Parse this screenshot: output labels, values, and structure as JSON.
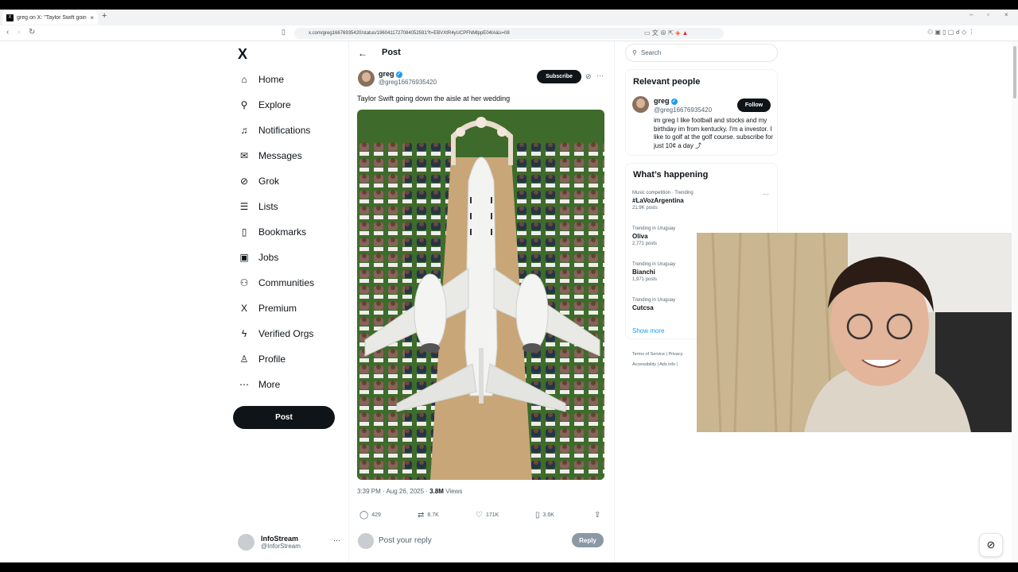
{
  "browser": {
    "tab_title": "greg on X: \"Taylor Swift going d...",
    "tab_close": "×",
    "new_tab": "+",
    "url": "x.com/greg16676935420/status/1960411727084052591?t=EBVXtR4yUCPFNMlppE04IA&s=08",
    "window_controls": [
      "–",
      "▫",
      "×"
    ]
  },
  "nav": {
    "logo": "X",
    "items": [
      {
        "label": "Home",
        "icon": "⌂"
      },
      {
        "label": "Explore",
        "icon": "⚲"
      },
      {
        "label": "Notifications",
        "icon": "♫"
      },
      {
        "label": "Messages",
        "icon": "✉"
      },
      {
        "label": "Grok",
        "icon": "⊘"
      },
      {
        "label": "Lists",
        "icon": "☰"
      },
      {
        "label": "Bookmarks",
        "icon": "▯"
      },
      {
        "label": "Jobs",
        "icon": "▣"
      },
      {
        "label": "Communities",
        "icon": "⚇"
      },
      {
        "label": "Premium",
        "icon": "X"
      },
      {
        "label": "Verified Orgs",
        "icon": "ϟ"
      },
      {
        "label": "Profile",
        "icon": "♙"
      },
      {
        "label": "More",
        "icon": "⋯"
      }
    ],
    "post_button": "Post",
    "account": {
      "name": "InfoStream",
      "handle": "@InforStream",
      "menu": "···"
    }
  },
  "post": {
    "back": "←",
    "header_title": "Post",
    "author": {
      "name": "greg",
      "handle": "@greg16676935420"
    },
    "subscribe_label": "Subscribe",
    "menu": "···",
    "text": "Taylor Swift going down the aisle at her wedding",
    "time": "3:39 PM · Aug 26, 2025 · ",
    "views_count": "3.8M",
    "views_label": " Views",
    "actions": [
      {
        "name": "reply",
        "icon": "◯",
        "count": "429"
      },
      {
        "name": "repost",
        "icon": "⇄",
        "count": "8.7K"
      },
      {
        "name": "like",
        "icon": "♡",
        "count": "171K"
      },
      {
        "name": "bookmark",
        "icon": "▯",
        "count": "3.6K"
      },
      {
        "name": "share",
        "icon": "⇪",
        "count": ""
      }
    ],
    "reply_placeholder": "Post your reply",
    "reply_button": "Reply"
  },
  "sidebar": {
    "search_placeholder": "Search",
    "relevant_title": "Relevant people",
    "person": {
      "name": "greg",
      "handle": "@greg16676935420",
      "follow_label": "Follow",
      "bio": "im greg I like football and stocks and my birthday im from kentucky. I'm a investor. I like to golf at the golf course. subscribe for just 10¢ a day ⤴"
    },
    "happening_title": "What’s happening",
    "trends": [
      {
        "context": "Music competition · Trending",
        "name": "#LaVozArgentina",
        "count": "21.9K posts"
      },
      {
        "context": "Trending in Uruguay",
        "name": "Oliva",
        "count": "2,771 posts"
      },
      {
        "context": "Trending in Uruguay",
        "name": "Bianchi",
        "count": "1,971 posts"
      },
      {
        "context": "Trending in Uruguay",
        "name": "Cutcsa",
        "count": ""
      }
    ],
    "trend_menu": "···",
    "show_more": "Show more",
    "footer_line1": "Terms of Service  |  Privacy",
    "footer_line2": "Accessibility  |  Ads info  |"
  },
  "colors": {
    "accent": "#1d9bf0",
    "text": "#0f1419",
    "muted": "#536471"
  }
}
